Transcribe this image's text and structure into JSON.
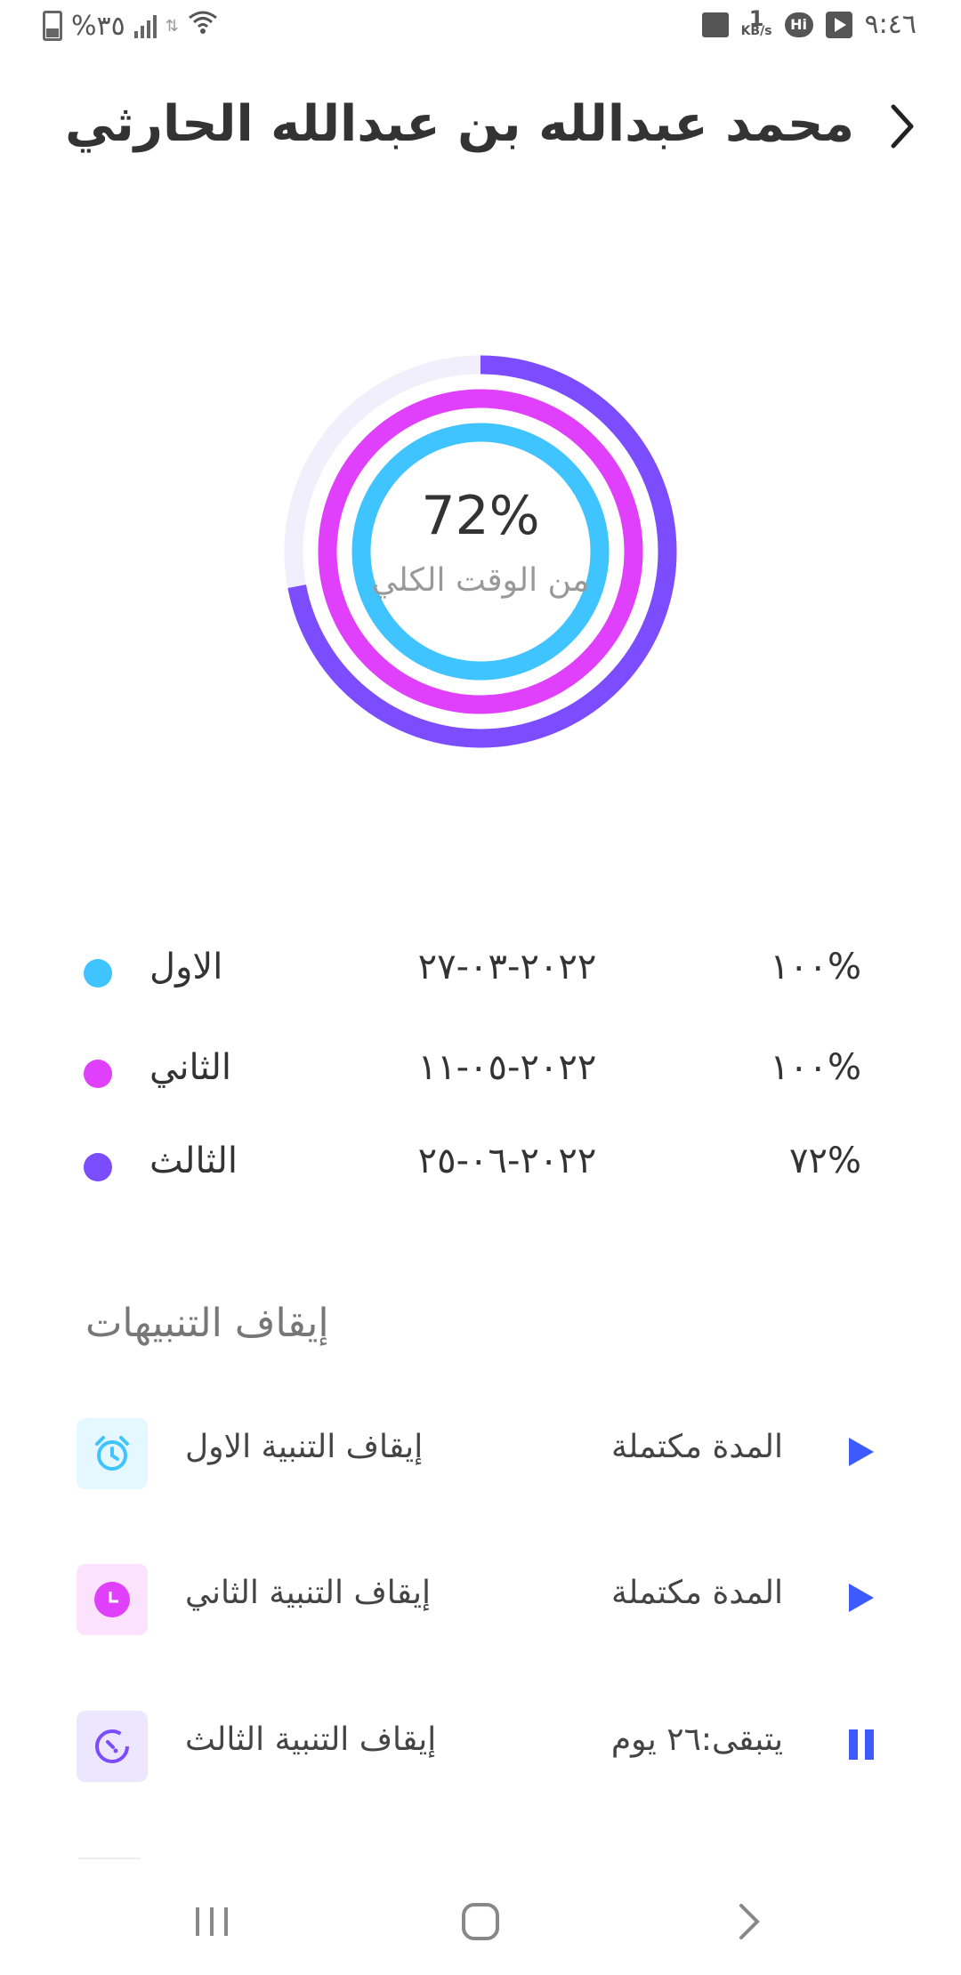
{
  "status_bar": {
    "time": "٩:٤٦",
    "net_speed_value": "1",
    "net_speed_unit": "KB/s",
    "hi_label": "Hi",
    "battery": "%٣٥"
  },
  "header": {
    "title": "محمد عبدالله بن عبدالله الحارثي"
  },
  "progress": {
    "center_value": "72%",
    "center_label": "من الوقت الكلي",
    "rings": [
      {
        "name": "الاول",
        "fraction": 1.0,
        "color": "#40c4ff"
      },
      {
        "name": "الثاني",
        "fraction": 1.0,
        "color": "#e040fb"
      },
      {
        "name": "الثالث",
        "fraction": 0.72,
        "color": "#7c4dff"
      }
    ],
    "track_color": "#f1effb"
  },
  "legend": [
    {
      "name": "الاول",
      "date": "٢٠٢٢-٠٣-٢٧",
      "percent": "١٠٠%",
      "color": "#40c4ff"
    },
    {
      "name": "الثاني",
      "date": "٢٠٢٢-٠٥-١١",
      "percent": "١٠٠%",
      "color": "#e040fb"
    },
    {
      "name": "الثالث",
      "date": "٢٠٢٢-٠٦-٢٥",
      "percent": "٧٢%",
      "color": "#7c4dff"
    }
  ],
  "alarms": {
    "section_title": "إيقاف التنبيهات",
    "items": [
      {
        "label": "إيقاف التنبية الاول",
        "status": "المدة مكتملة",
        "icon": "alarm-clock-icon",
        "action": "play",
        "color": "#40c4ff",
        "bg": "#e6f8ff"
      },
      {
        "label": "إيقاف التنبية الثاني",
        "status": "المدة مكتملة",
        "icon": "clock-icon",
        "action": "play",
        "color": "#e040fb",
        "bg": "#fbe3fe"
      },
      {
        "label": "إيقاف التنبية الثالث",
        "status": "يتبقى:٢٦ يوم",
        "icon": "timer-icon",
        "action": "pause",
        "color": "#7c4dff",
        "bg": "#ece6ff"
      }
    ],
    "action_color": "#3d5afe"
  }
}
